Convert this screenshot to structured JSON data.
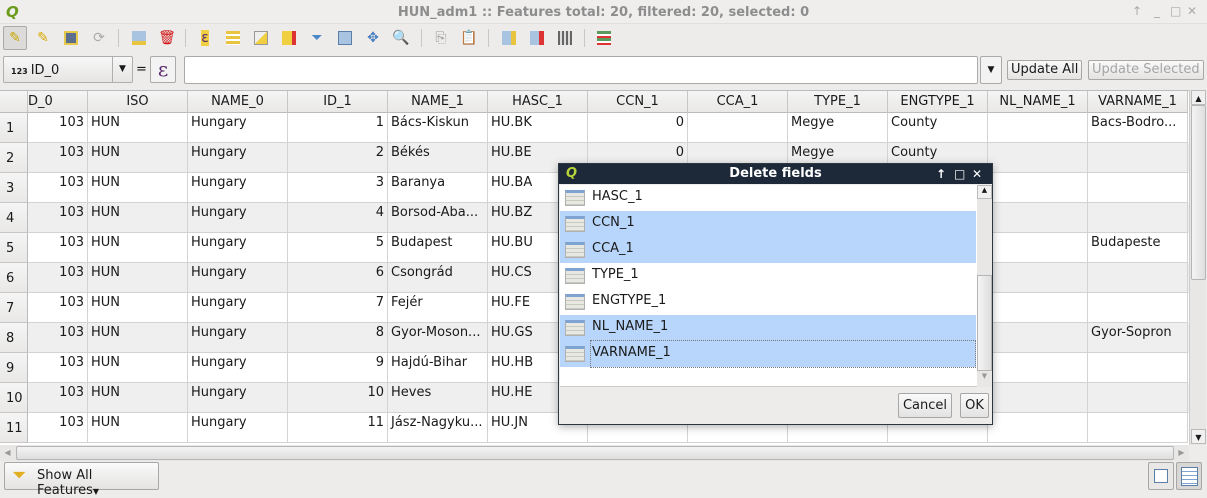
{
  "window": {
    "title": "HUN_adm1 :: Features total: 20, filtered: 20, selected: 0"
  },
  "filter": {
    "field_type": "123",
    "field": "ID_0",
    "equals": "=",
    "expression": "",
    "update_all": "Update All",
    "update_selected": "Update Selected"
  },
  "columns": [
    "D_0",
    "ISO",
    "NAME_0",
    "ID_1",
    "NAME_1",
    "HASC_1",
    "CCN_1",
    "CCA_1",
    "TYPE_1",
    "ENGTYPE_1",
    "NL_NAME_1",
    "VARNAME_1"
  ],
  "rows": [
    {
      "n": "1",
      "c": [
        "103",
        "HUN",
        "Hungary",
        "1",
        "Bács-Kiskun",
        "HU.BK",
        "0",
        "",
        "Megye",
        "County",
        "",
        "Bacs-Bodro..."
      ]
    },
    {
      "n": "2",
      "c": [
        "103",
        "HUN",
        "Hungary",
        "2",
        "Békés",
        "HU.BE",
        "0",
        "",
        "Megye",
        "County",
        "",
        ""
      ]
    },
    {
      "n": "3",
      "c": [
        "103",
        "HUN",
        "Hungary",
        "3",
        "Baranya",
        "HU.BA",
        "",
        "",
        "",
        "",
        "",
        ""
      ]
    },
    {
      "n": "4",
      "c": [
        "103",
        "HUN",
        "Hungary",
        "4",
        "Borsod-Aba...",
        "HU.BZ",
        "",
        "",
        "",
        "",
        "",
        ""
      ]
    },
    {
      "n": "5",
      "c": [
        "103",
        "HUN",
        "Hungary",
        "5",
        "Budapest",
        "HU.BU",
        "",
        "",
        "",
        "",
        "",
        "Budapeste"
      ]
    },
    {
      "n": "6",
      "c": [
        "103",
        "HUN",
        "Hungary",
        "6",
        "Csongrád",
        "HU.CS",
        "",
        "",
        "",
        "",
        "",
        ""
      ]
    },
    {
      "n": "7",
      "c": [
        "103",
        "HUN",
        "Hungary",
        "7",
        "Fejér",
        "HU.FE",
        "",
        "",
        "",
        "",
        "",
        ""
      ]
    },
    {
      "n": "8",
      "c": [
        "103",
        "HUN",
        "Hungary",
        "8",
        "Gyor-Moson...",
        "HU.GS",
        "",
        "",
        "",
        "",
        "",
        "Gyor-Sopron"
      ]
    },
    {
      "n": "9",
      "c": [
        "103",
        "HUN",
        "Hungary",
        "9",
        "Hajdú-Bihar",
        "HU.HB",
        "",
        "",
        "",
        "",
        "",
        ""
      ]
    },
    {
      "n": "10",
      "c": [
        "103",
        "HUN",
        "Hungary",
        "10",
        "Heves",
        "HU.HE",
        "",
        "",
        "",
        "",
        "",
        ""
      ]
    },
    {
      "n": "11",
      "c": [
        "103",
        "HUN",
        "Hungary",
        "11",
        "Jász-Nagyku...",
        "HU.JN",
        "",
        "",
        "",
        "",
        "",
        ""
      ]
    }
  ],
  "bottom": {
    "show_all": "Show All Features"
  },
  "dialog": {
    "title": "Delete fields",
    "fields": [
      {
        "label": "HASC_1",
        "selected": false
      },
      {
        "label": "CCN_1",
        "selected": true
      },
      {
        "label": "CCA_1",
        "selected": true
      },
      {
        "label": "TYPE_1",
        "selected": false
      },
      {
        "label": "ENGTYPE_1",
        "selected": false
      },
      {
        "label": "NL_NAME_1",
        "selected": true
      },
      {
        "label": "VARNAME_1",
        "selected": true
      }
    ],
    "cancel": "Cancel",
    "ok": "OK"
  },
  "colors": {
    "selection": "#b8d6fb",
    "dialog_title": "#1d2838"
  }
}
